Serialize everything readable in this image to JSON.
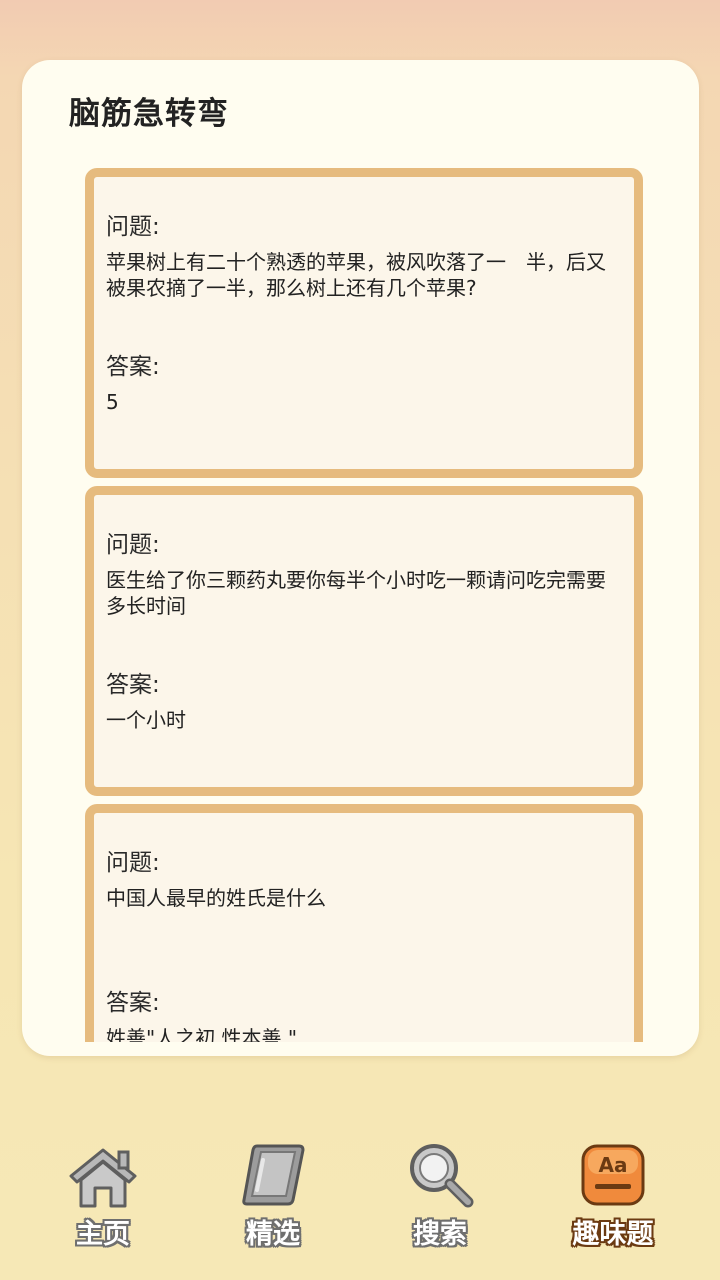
{
  "page": {
    "title": "脑筋急转弯"
  },
  "labels": {
    "question": "问题:",
    "answer": "答案:"
  },
  "cards": [
    {
      "question": "苹果树上有二十个熟透的苹果，被风吹落了一　半，后又被果农摘了一半，那么树上还有几个苹果?",
      "answer": "5"
    },
    {
      "question": "医生给了你三颗药丸要你每半个小时吃一颗请问吃完需要多长时间",
      "answer": "一个小时"
    },
    {
      "question": "中国人最早的姓氏是什么",
      "answer": "姓善\"人之初,性本善.\""
    }
  ],
  "tabbar": {
    "items": [
      {
        "label": "主页",
        "icon": "house-icon",
        "active": false
      },
      {
        "label": "精选",
        "icon": "book-icon",
        "active": false
      },
      {
        "label": "搜索",
        "icon": "magnifier-icon",
        "active": false
      },
      {
        "label": "趣味题",
        "icon": "font-aa-icon",
        "active": true
      }
    ]
  },
  "colors": {
    "card_border": "#e6bb7e",
    "card_bg": "#fcf6ea",
    "active_tab": "#f08a3c"
  }
}
